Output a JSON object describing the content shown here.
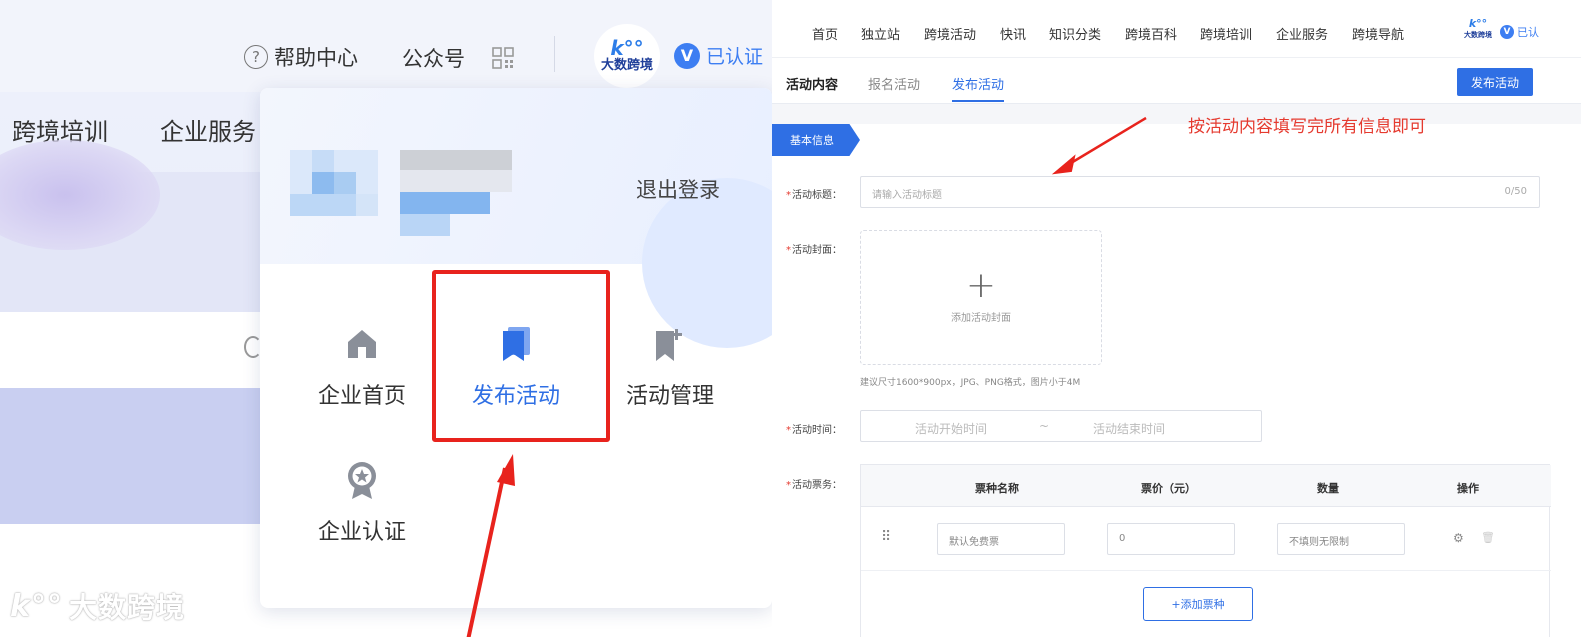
{
  "left_panel": {
    "header": {
      "help_center": "帮助中心",
      "help_icon_char": "?",
      "official_account": "公众号",
      "verified": "已认证",
      "verified_icon_char": "V",
      "brand_mark": "k°°",
      "brand_name": "大数跨境"
    },
    "nav": [
      "跨境培训",
      "企业服务"
    ],
    "dropdown": {
      "logout": "退出登录",
      "items": [
        {
          "label": "企业首页",
          "icon": "home-icon"
        },
        {
          "label": "发布活动",
          "icon": "bookmark-icon",
          "active": true
        },
        {
          "label": "活动管理",
          "icon": "bookmark-plus-icon"
        },
        {
          "label": "企业认证",
          "icon": "badge-star-icon"
        }
      ]
    },
    "watermark": {
      "mark": "k°°",
      "text": "大数跨境"
    },
    "colors": {
      "accent": "#2f6fe4",
      "highlight": "#e8231d"
    }
  },
  "right_panel": {
    "top_nav": [
      "首页",
      "独立站",
      "跨境活动",
      "快讯",
      "知识分类",
      "跨境百科",
      "跨境培训",
      "企业服务",
      "跨境导航"
    ],
    "brand_mark": "k°°",
    "brand_name": "大数跨境",
    "verified_short": "已认",
    "verified_icon_char": "V",
    "tabs": {
      "content": "活动内容",
      "signup": "报名活动",
      "publish": "发布活动"
    },
    "publish_button": "发布活动",
    "section_label": "基本信息",
    "annotation": "按活动内容填写完所有信息即可",
    "form": {
      "title_label": "活动标题：",
      "title_placeholder": "请输入活动标题",
      "title_count": "0/50",
      "cover_label": "活动封面：",
      "cover_plus": "+",
      "cover_text": "添加活动封面",
      "cover_hint": "建议尺寸1600*900px，JPG、PNG格式，图片小于4M",
      "time_label": "活动时间：",
      "time_start": "活动开始时间",
      "time_sep": "~",
      "time_end": "活动结束时间",
      "ticket_label": "活动票务：",
      "required_mark": "*"
    },
    "ticket_table": {
      "headers": {
        "name": "票种名称",
        "price": "票价（元）",
        "qty": "数量",
        "ops": "操作"
      },
      "row": {
        "drag_handle": "⠿",
        "name_value": "默认免费票",
        "price_value": "0",
        "qty_placeholder": "不填则无限制",
        "settings_icon": "⚙",
        "delete_icon": "🗑"
      },
      "add_button": "+添加票种"
    }
  }
}
